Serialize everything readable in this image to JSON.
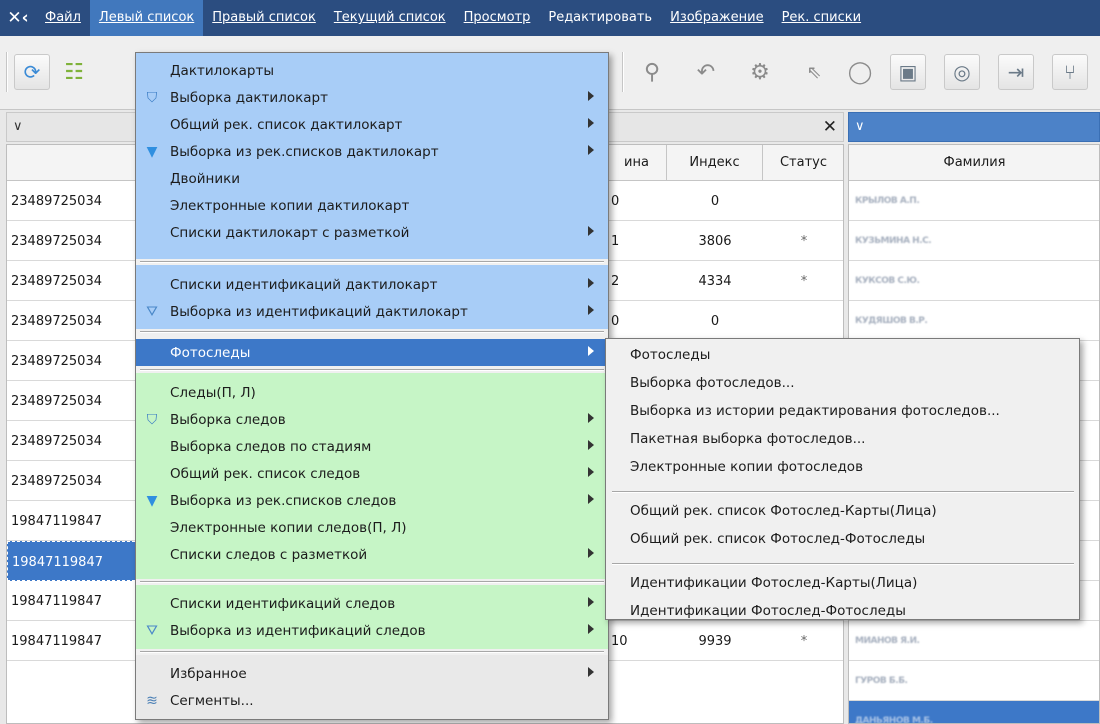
{
  "menubar": {
    "items": [
      {
        "label": "Файл",
        "active": false
      },
      {
        "label": "Левый список",
        "active": true
      },
      {
        "label": "Правый список",
        "active": false
      },
      {
        "label": "Текущий список",
        "active": false
      },
      {
        "label": "Просмотр",
        "active": false
      },
      {
        "label": "Редактировать",
        "active": false
      },
      {
        "label": "Изображение",
        "active": false
      },
      {
        "label": "Рек. списки",
        "active": false
      }
    ]
  },
  "toolbar": {
    "icons": [
      "refresh-icon",
      "list-view-icon",
      "search-icon",
      "undo-icon",
      "gears-icon",
      "pointer-icon",
      "circle-icon",
      "image-icon",
      "fingerprint-icon",
      "split-icon",
      "branch-icon"
    ]
  },
  "left_grid": {
    "headers": [
      "",
      "ина",
      "Индекс",
      "Статус"
    ],
    "rows": [
      {
        "id": "23489725034",
        "n": "0",
        "index": "0",
        "status": ""
      },
      {
        "id": "23489725034",
        "n": "1",
        "index": "3806",
        "status": "*"
      },
      {
        "id": "23489725034",
        "n": "2",
        "index": "4334",
        "status": "*"
      },
      {
        "id": "23489725034",
        "n": "0",
        "index": "0",
        "status": ""
      },
      {
        "id": "23489725034",
        "n": "",
        "index": "",
        "status": ""
      },
      {
        "id": "23489725034",
        "n": "",
        "index": "",
        "status": ""
      },
      {
        "id": "23489725034",
        "n": "",
        "index": "",
        "status": ""
      },
      {
        "id": "23489725034",
        "n": "",
        "index": "",
        "status": ""
      },
      {
        "id": "19847119847",
        "n": "",
        "index": "",
        "status": ""
      },
      {
        "id": "19847119847",
        "n": "",
        "index": "",
        "status": "",
        "selected": true
      },
      {
        "id": "19847119847",
        "n": "",
        "index": "",
        "status": ""
      },
      {
        "id": "19847119847",
        "n": "10",
        "index": "9939",
        "status": "*"
      }
    ]
  },
  "right_grid": {
    "header": "Фамилия",
    "rows": [
      "КРЫЛОВ А.П.",
      "КУЗЬМИНА Н.С.",
      "КУКСОВ С.Ю.",
      "КУДЯШОВ В.Р.",
      "",
      "",
      "",
      "",
      "",
      "",
      "",
      "МИАНОВ Я.И.",
      "ГУРОВ Б.Б.",
      "ДАНЬЯНОВ М.Б."
    ]
  },
  "dropdown": {
    "group1": [
      {
        "label": "Дактилокарты",
        "icon": "",
        "sub": false
      },
      {
        "label": "Выборка дактилокарт",
        "icon": "filter-doc-icon",
        "sub": true
      },
      {
        "label": "Общий рек. список дактилокарт",
        "icon": "",
        "sub": true
      },
      {
        "label": "Выборка из рек.списков дактилокарт",
        "icon": "funnel-icon",
        "sub": true
      },
      {
        "label": "Двойники",
        "icon": "",
        "sub": false
      },
      {
        "label": "Электронные копии дактилокарт",
        "icon": "",
        "sub": false
      },
      {
        "label": "Списки дактилокарт с разметкой",
        "icon": "",
        "sub": true
      }
    ],
    "group2": [
      {
        "label": "Списки идентификаций дактилокарт",
        "icon": "",
        "sub": true
      },
      {
        "label": "Выборка из идентификаций дактилокарт",
        "icon": "filter-id-icon",
        "sub": true
      }
    ],
    "group3": [
      {
        "label": "Фотоследы",
        "icon": "",
        "sub": true,
        "highlighted": true
      }
    ],
    "group4": [
      {
        "label": "Следы(П, Л)",
        "icon": "",
        "sub": false
      },
      {
        "label": "Выборка следов",
        "icon": "filter-doc-icon",
        "sub": true
      },
      {
        "label": "Выборка следов по стадиям",
        "icon": "",
        "sub": true
      },
      {
        "label": "Общий рек. список следов",
        "icon": "",
        "sub": true
      },
      {
        "label": "Выборка из рек.списков следов",
        "icon": "funnel-icon",
        "sub": true
      },
      {
        "label": "Электронные копии следов(П, Л)",
        "icon": "",
        "sub": false
      },
      {
        "label": "Списки следов с разметкой",
        "icon": "",
        "sub": true
      }
    ],
    "group5": [
      {
        "label": "Списки идентификаций следов",
        "icon": "",
        "sub": true
      },
      {
        "label": "Выборка из идентификаций следов",
        "icon": "filter-id-icon",
        "sub": true
      }
    ],
    "group6": [
      {
        "label": "Избранное",
        "icon": "",
        "sub": true
      },
      {
        "label": "Сегменты...",
        "icon": "database-icon",
        "sub": false
      }
    ],
    "colors": {
      "group_blue": "#a8cdf7",
      "group_green": "#c6f5c6",
      "group_gray": "#e9e9e9",
      "highlight": "#3d78c8"
    }
  },
  "submenu": {
    "items_a": [
      "Фотоследы",
      "Выборка фотоследов...",
      "Выборка из истории редактирования фотоследов...",
      "Пакетная выборка фотоследов...",
      "Электронные копии фотоследов"
    ],
    "items_b": [
      "Общий рек. список Фотослед-Карты(Лица)",
      "Общий рек. список Фотослед-Фотоследы"
    ],
    "items_c": [
      "Идентификации Фотослед-Карты(Лица)",
      "Идентификации Фотослед-Фотоследы"
    ]
  }
}
